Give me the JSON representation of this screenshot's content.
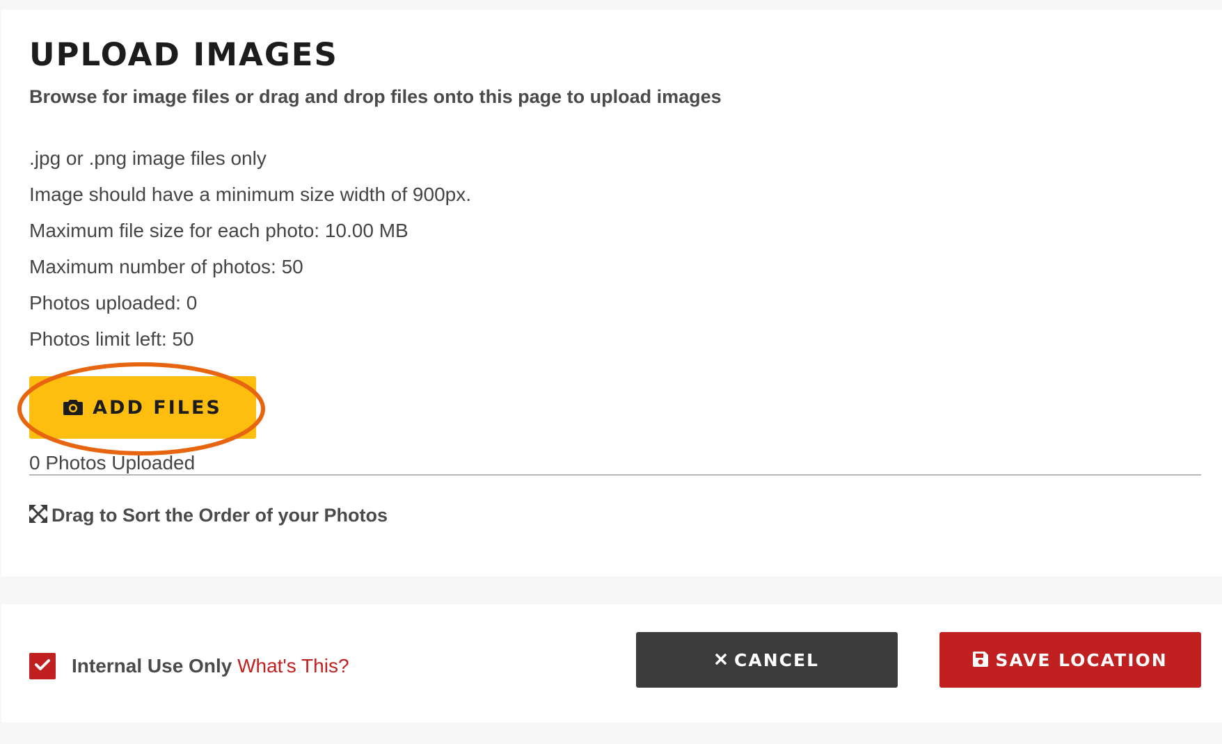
{
  "upload": {
    "title": "UPLOAD IMAGES",
    "subtitle": "Browse for image files or drag and drop files onto this page to upload images",
    "requirements": [
      ".jpg or .png image files only",
      "Image should have a minimum size width of 900px.",
      "Maximum file size for each photo: 10.00 MB",
      "Maximum number of photos: 50",
      "Photos uploaded: 0",
      "Photos limit left: 50"
    ],
    "add_files_label": "ADD FILES",
    "add_files_icon": "camera-icon",
    "photos_count_text": "0 Photos Uploaded",
    "sort_label": "Drag to Sort the Order of your Photos",
    "sort_icon": "expand-arrows-icon"
  },
  "footer": {
    "internal_use_label": "Internal Use Only",
    "internal_use_checked": true,
    "whats_this_label": "What's This?",
    "cancel_label": "CANCEL",
    "cancel_icon": "close-icon",
    "save_label": "SAVE LOCATION",
    "save_icon": "floppy-disk-icon"
  },
  "colors": {
    "accent_yellow": "#fdbe10",
    "highlight_orange": "#e8650f",
    "brand_red": "#c0201f",
    "dark_button": "#3b3b3b",
    "page_background": "#f7f7f7"
  }
}
